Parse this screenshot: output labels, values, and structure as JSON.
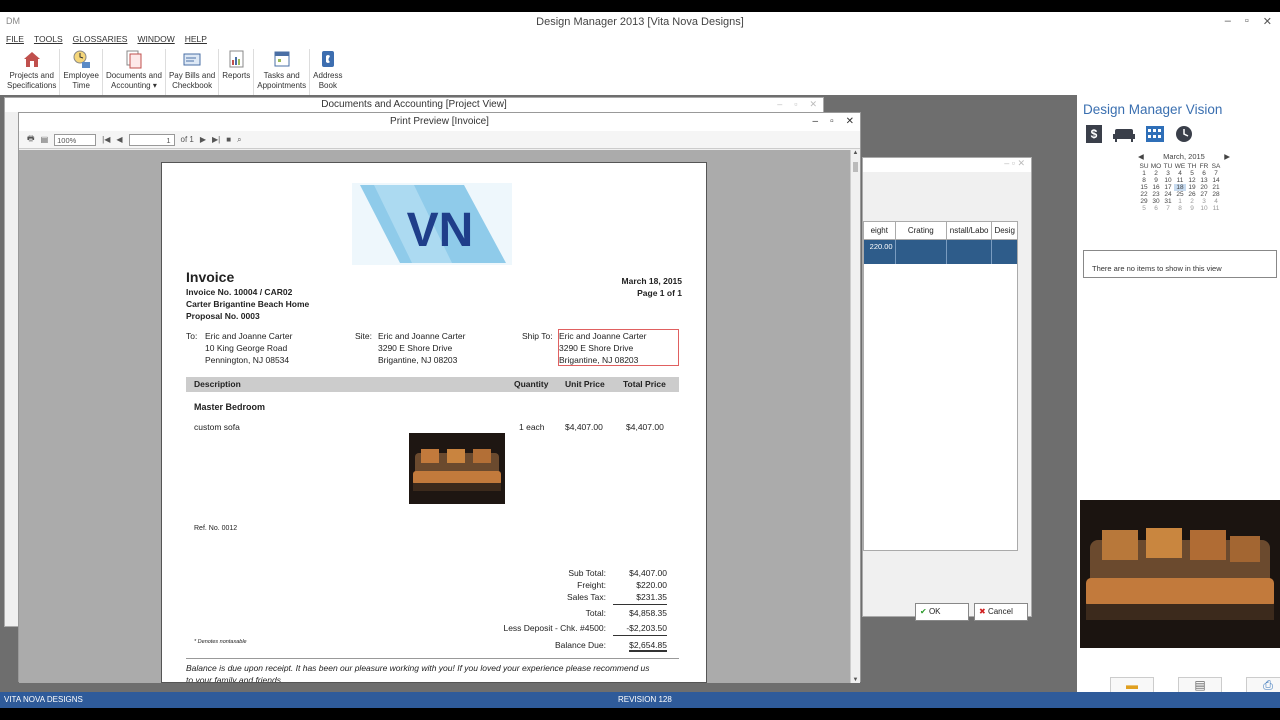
{
  "app": {
    "logo": "DM",
    "title": "Design Manager 2013 [Vita Nova Designs]",
    "menu": [
      "FILE",
      "TOOLS",
      "GLOSSARIES",
      "WINDOW",
      "HELP"
    ],
    "ribbon": [
      {
        "line1": "Projects and",
        "line2": "Specifications",
        "icon": "house-icon"
      },
      {
        "line1": "Employee",
        "line2": "Time",
        "icon": "clock-person-icon"
      },
      {
        "line1": "Documents and",
        "line2": "Accounting ▾",
        "icon": "documents-icon"
      },
      {
        "line1": "Pay Bills and",
        "line2": "Checkbook",
        "icon": "checkbook-icon"
      },
      {
        "line1": "Reports",
        "line2": "",
        "icon": "reports-icon"
      },
      {
        "line1": "Tasks and",
        "line2": "Appointments",
        "icon": "calendar-icon"
      },
      {
        "line1": "Address",
        "line2": "Book",
        "icon": "phone-book-icon"
      }
    ],
    "status_left": "VITA NOVA DESIGNS",
    "status_right": "REVISION 128"
  },
  "docs_window": {
    "title": "Documents and Accounting [Project View]"
  },
  "behind_dialog": {
    "columns": [
      "eight",
      "Crating",
      "nstall/Labo",
      "Desig"
    ],
    "selected_value": "220.00",
    "ok_label": "OK",
    "cancel_label": "Cancel"
  },
  "print_preview": {
    "title": "Print Preview [Invoice]",
    "zoom": "100%",
    "page_input": "1",
    "page_of": "of 1"
  },
  "invoice": {
    "heading": "Invoice",
    "number": "Invoice No. 10004 / CAR02",
    "project": "Carter Brigantine Beach Home",
    "proposal": "Proposal No. 0003",
    "date": "March 18, 2015",
    "page": "Page 1 of 1",
    "logo_text": "VN",
    "to_label": "To:",
    "to": [
      "Eric and Joanne Carter",
      "10 King George Road",
      "Pennington, NJ  08534"
    ],
    "site_label": "Site:",
    "site": [
      "Eric and Joanne Carter",
      "3290 E Shore Drive",
      "Brigantine, NJ  08203"
    ],
    "ship_label": "Ship To:",
    "ship": [
      "Eric and Joanne Carter",
      "3290 E Shore Drive",
      "Brigantine, NJ  08203"
    ],
    "columns": {
      "description": "Description",
      "quantity": "Quantity",
      "unit_price": "Unit Price",
      "total_price": "Total Price"
    },
    "section": "Master Bedroom",
    "item": {
      "description": "custom sofa",
      "quantity": "1 each",
      "unit_price": "$4,407.00",
      "total": "$4,407.00"
    },
    "ref": "Ref. No. 0012",
    "totals": [
      {
        "label": "Sub Total:",
        "value": "$4,407.00"
      },
      {
        "label": "Freight:",
        "value": "$220.00"
      },
      {
        "label": "Sales Tax:",
        "value": "$231.35"
      },
      {
        "label": "Total:",
        "value": "$4,858.35"
      },
      {
        "label": "Less Deposit - Chk. #4500:",
        "value": "-$2,203.50"
      },
      {
        "label": "Balance Due:",
        "value": "$2,654.85"
      }
    ],
    "note": "* Denotes nontaxable",
    "footer_line1": "Balance is due upon receipt.  It has been our pleasure working with you!  If you loved your experience please recommend us",
    "footer_line2": "to your family and friends."
  },
  "vision": {
    "title": "Design Manager Vision",
    "calendar_month": "March, 2015",
    "weekdays": [
      "SU",
      "MO",
      "TU",
      "WE",
      "TH",
      "FR",
      "SA"
    ],
    "weeks": [
      [
        "",
        "",
        "",
        "",
        "",
        "",
        ""
      ],
      [
        "1",
        "2",
        "3",
        "4",
        "5",
        "6",
        "7"
      ],
      [
        "8",
        "9",
        "10",
        "11",
        "12",
        "13",
        "14"
      ],
      [
        "15",
        "16",
        "17",
        "18",
        "19",
        "20",
        "21"
      ],
      [
        "22",
        "23",
        "24",
        "25",
        "26",
        "27",
        "28"
      ],
      [
        "29",
        "30",
        "31",
        "1",
        "2",
        "3",
        "4"
      ],
      [
        "5",
        "6",
        "7",
        "8",
        "9",
        "10",
        "11"
      ]
    ],
    "empty_message": "There are no items to show in this view"
  }
}
